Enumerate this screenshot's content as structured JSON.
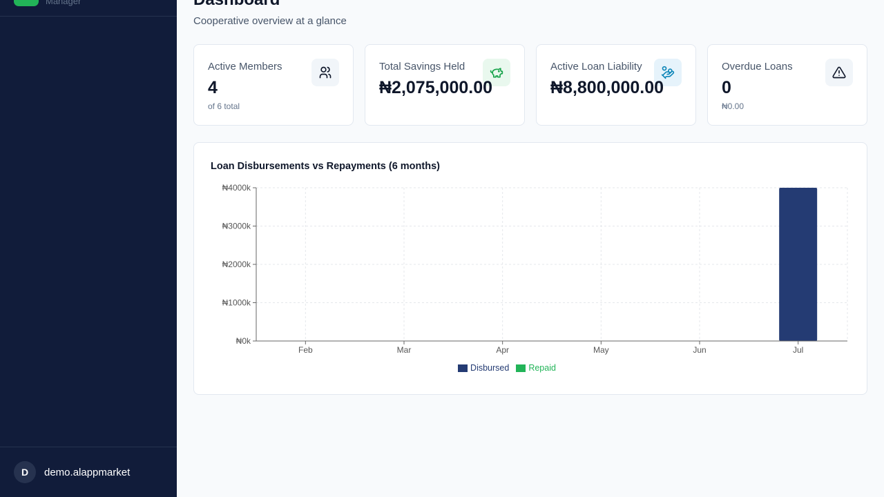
{
  "sidebar": {
    "brand_subtitle": "Manager",
    "user": {
      "initial": "D",
      "name": "demo.alappmarket"
    }
  },
  "header": {
    "title": "Dashboard",
    "subtitle": "Cooperative overview at a glance"
  },
  "stats": [
    {
      "label": "Active Members",
      "value": "4",
      "sub": "of 6 total",
      "icon": "users-icon",
      "icon_bg": "#f1f5f9",
      "icon_color": "#0f172a"
    },
    {
      "label": "Total Savings Held",
      "value": "₦2,075,000.00",
      "sub": "",
      "icon": "piggy-bank-icon",
      "icon_bg": "#e9f8ee",
      "icon_color": "#16a34a"
    },
    {
      "label": "Active Loan Liability",
      "value": "₦8,800,000.00",
      "sub": "",
      "icon": "hand-coins-icon",
      "icon_bg": "#e6f3fb",
      "icon_color": "#0e86b8"
    },
    {
      "label": "Overdue Loans",
      "value": "0",
      "sub": "₦0.00",
      "icon": "alert-triangle-icon",
      "icon_bg": "#f1f5f9",
      "icon_color": "#0f172a"
    }
  ],
  "chart_data": {
    "type": "bar",
    "title": "Loan Disbursements vs Repayments (6 months)",
    "categories": [
      "Feb",
      "Mar",
      "Apr",
      "May",
      "Jun",
      "Jul"
    ],
    "series": [
      {
        "name": "Disbursed",
        "values": [
          0,
          0,
          0,
          0,
          0,
          4000
        ],
        "color": "#243b73"
      },
      {
        "name": "Repaid",
        "values": [
          0,
          0,
          0,
          0,
          0,
          0
        ],
        "color": "#22b458"
      }
    ],
    "units": "₦ thousands",
    "yticks": [
      "₦0k",
      "₦1000k",
      "₦2000k",
      "₦3000k",
      "₦4000k"
    ],
    "ylim": [
      0,
      4000
    ],
    "grid": true,
    "legend": "bottom-center"
  }
}
